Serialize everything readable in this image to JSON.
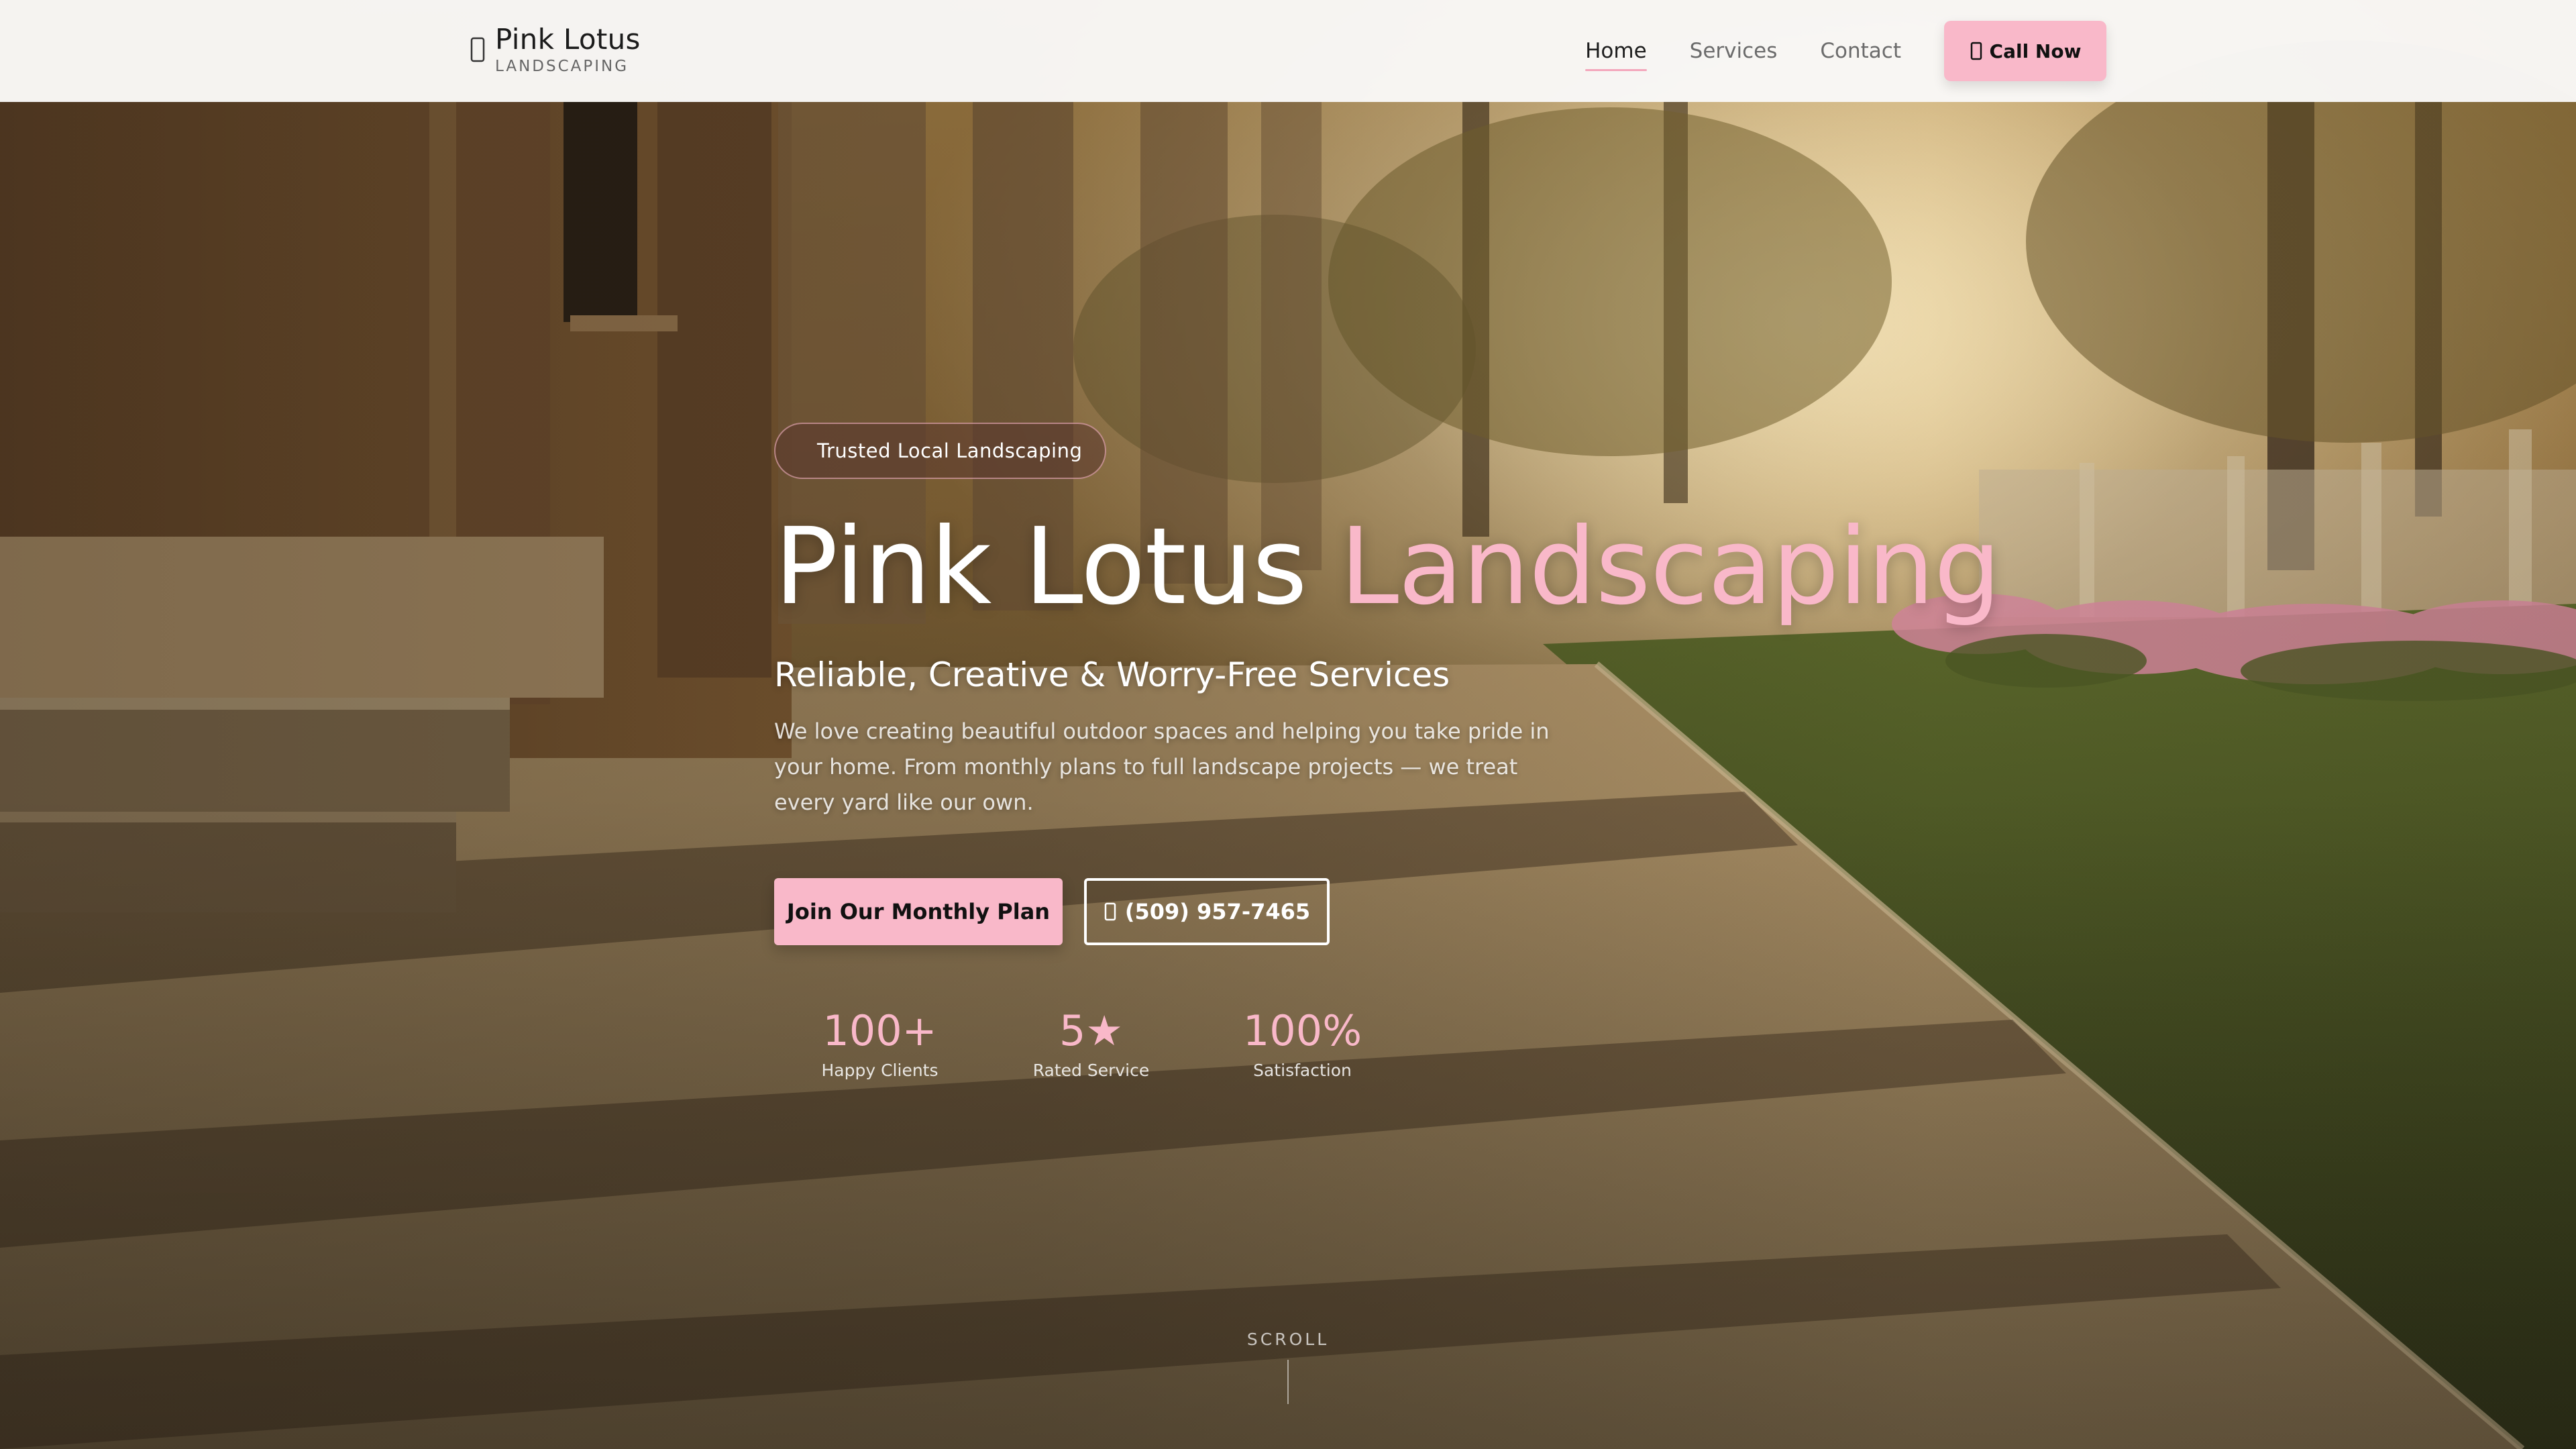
{
  "header": {
    "brand_name": "Pink Lotus",
    "brand_sub": "LANDSCAPING",
    "brand_icon": "lotus-icon",
    "nav": [
      {
        "label": "Home",
        "active": true
      },
      {
        "label": "Services",
        "active": false
      },
      {
        "label": "Contact",
        "active": false
      }
    ],
    "call_button": {
      "label": "Call Now",
      "icon": "phone-icon"
    }
  },
  "hero": {
    "badge": "Trusted Local Landscaping",
    "title_main": "Pink Lotus",
    "title_accent": "Landscaping",
    "tagline": "Reliable, Creative & Worry-Free Services",
    "description": "We love creating beautiful outdoor spaces and helping you take pride in your home. From monthly plans to full landscape projects — we treat every yard like our own.",
    "primary_button": "Join Our Monthly Plan",
    "phone_button": "(509) 957-7465",
    "stats": [
      {
        "value": "100+",
        "label": "Happy Clients"
      },
      {
        "value": "5★",
        "label": "Rated Service"
      },
      {
        "value": "100%",
        "label": "Satisfaction"
      }
    ],
    "scroll_label": "SCROLL"
  },
  "colors": {
    "accent_pink": "#f9b8c9",
    "header_bg": "#f9f8f7",
    "text_dark": "#1b1b1b"
  }
}
